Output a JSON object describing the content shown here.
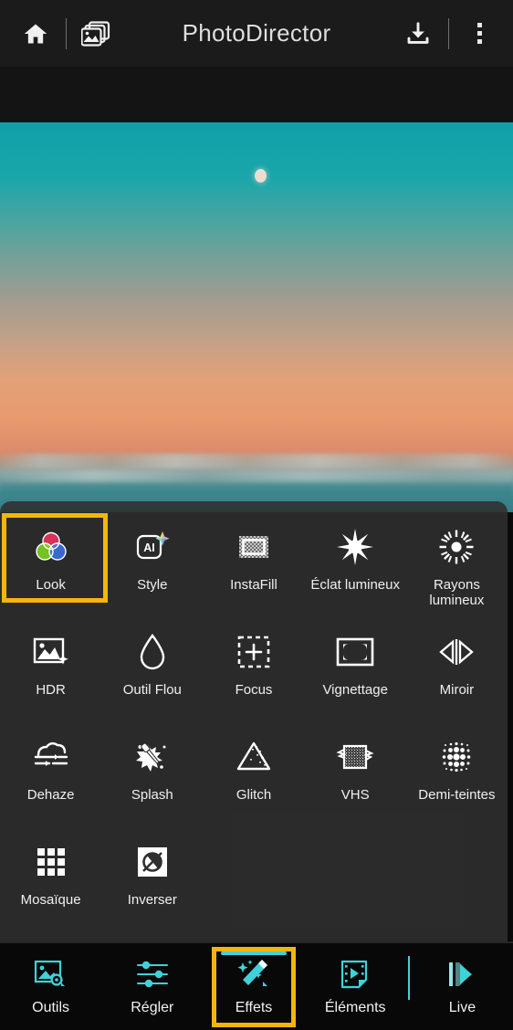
{
  "header": {
    "title": "PhotoDirector",
    "home_icon": "home-icon",
    "gallery_icon": "gallery-stack-icon",
    "download_icon": "download-icon",
    "menu_icon": "more-vertical-icon"
  },
  "photo": {
    "description": "sunset-sky-over-sea",
    "moon": "moon"
  },
  "effects_panel": {
    "selected": "Look",
    "items": [
      {
        "label": "Look",
        "icon": "color-circles-icon"
      },
      {
        "label": "Style",
        "icon": "ai-badge-icon"
      },
      {
        "label": "InstaFill",
        "icon": "instafill-frame-icon"
      },
      {
        "label": "Éclat lumineux",
        "icon": "starburst-icon"
      },
      {
        "label": "Rayons lumineux",
        "icon": "light-rays-icon"
      },
      {
        "label": "HDR",
        "icon": "hdr-photo-icon"
      },
      {
        "label": "Outil Flou",
        "icon": "water-drop-icon"
      },
      {
        "label": "Focus",
        "icon": "focus-crosshair-icon"
      },
      {
        "label": "Vignettage",
        "icon": "vignette-frame-icon"
      },
      {
        "label": "Miroir",
        "icon": "mirror-icon"
      },
      {
        "label": "Dehaze",
        "icon": "dehaze-cloud-icon"
      },
      {
        "label": "Splash",
        "icon": "splash-eyedropper-icon"
      },
      {
        "label": "Glitch",
        "icon": "glitch-triangle-icon"
      },
      {
        "label": "VHS",
        "icon": "vhs-noise-icon"
      },
      {
        "label": "Demi-teintes",
        "icon": "halftone-dots-icon"
      },
      {
        "label": "Mosaïque",
        "icon": "mosaic-grid-icon"
      },
      {
        "label": "Inverser",
        "icon": "invert-icon"
      }
    ]
  },
  "bottom_nav": {
    "selected": "Effets",
    "items": [
      {
        "label": "Outils",
        "icon": "image-gear-icon"
      },
      {
        "label": "Régler",
        "icon": "sliders-icon"
      },
      {
        "label": "Effets",
        "icon": "magic-wand-icon"
      },
      {
        "label": "Éléments",
        "icon": "sticker-film-icon"
      },
      {
        "label": "Live",
        "icon": "live-play-icon"
      }
    ]
  },
  "colors": {
    "accent_selection": "#F5B50A",
    "nav_teal": "#3fd2d8",
    "header_bg": "#1b1b1b",
    "panel_bg": "rgba(47,47,47,.88)"
  }
}
